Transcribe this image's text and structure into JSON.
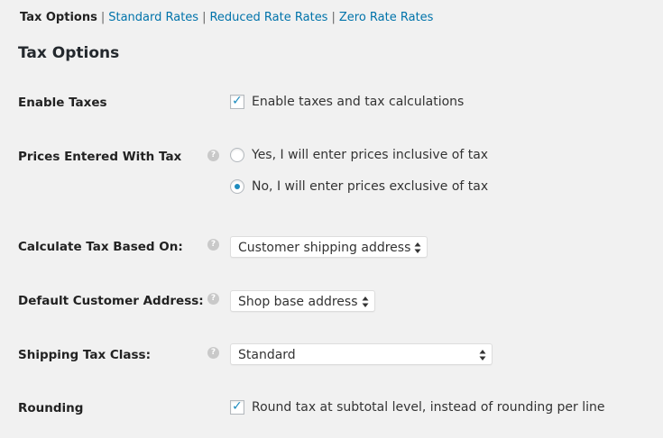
{
  "subnav": {
    "tabs": [
      {
        "label": "Tax Options",
        "current": true
      },
      {
        "label": "Standard Rates",
        "current": false
      },
      {
        "label": "Reduced Rate Rates",
        "current": false
      },
      {
        "label": "Zero Rate Rates",
        "current": false
      }
    ],
    "separator": "|"
  },
  "page": {
    "title": "Tax Options"
  },
  "help_icon_glyph": "?",
  "check_glyph": "✓",
  "fields": {
    "enable_taxes": {
      "label": "Enable Taxes",
      "checkbox_label": "Enable taxes and tax calculations",
      "checked": true
    },
    "prices_entered_with_tax": {
      "label": "Prices Entered With Tax",
      "options": [
        {
          "label": "Yes, I will enter prices inclusive of tax",
          "selected": false
        },
        {
          "label": "No, I will enter prices exclusive of tax",
          "selected": true
        }
      ]
    },
    "calculate_tax_based_on": {
      "label": "Calculate Tax Based On:",
      "selected": "Customer shipping address"
    },
    "default_customer_address": {
      "label": "Default Customer Address:",
      "selected": "Shop base address"
    },
    "shipping_tax_class": {
      "label": "Shipping Tax Class:",
      "selected": "Standard"
    },
    "rounding": {
      "label": "Rounding",
      "checkbox_label": "Round tax at subtotal level, instead of rounding per line",
      "checked": true
    }
  },
  "colors": {
    "background": "#f1f1f1",
    "link": "#0073aa",
    "accent": "#1e8cbe",
    "help_icon": "#c9c9c9"
  },
  "icons": {
    "help": "question-circle-icon",
    "select_arrows": "up-down-arrows-icon"
  }
}
